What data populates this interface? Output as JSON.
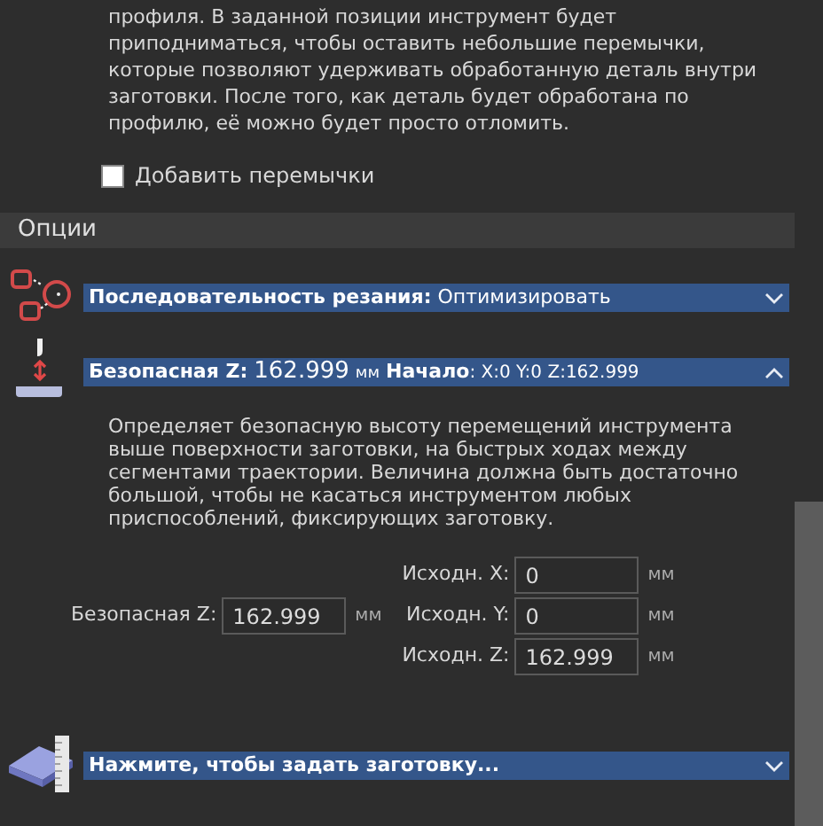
{
  "intro": {
    "text": "профиля. В заданной позиции инструмент будет приподниматься, чтобы оставить небольшие перемычки, которые позволяют удерживать обработанную деталь внутри заготовки. После того, как деталь будет обработана по профилю, её можно будет просто отломить."
  },
  "tabs_checkbox": {
    "label": "Добавить перемычки",
    "checked": false
  },
  "section": {
    "title": "Опции"
  },
  "cut_order": {
    "label": "Последовательность резания:",
    "value": "Оптимизировать",
    "expanded": false
  },
  "safe_z": {
    "label": "Безопасная Z:",
    "value": "162.999",
    "unit": "мм",
    "start_label": "Начало",
    "start_value": ": X:0 Y:0 Z:162.999",
    "expanded": true,
    "description": "Определяет безопасную высоту перемещений инструмента выше поверхности заготовки, на быстрых ходах между сегментами траектории. Величина должна быть достаточно большой, чтобы не касаться инструментом любых приспособлений, фиксирующих заготовку.",
    "field": {
      "label": "Безопасная Z:",
      "value": "162.999",
      "unit": "мм"
    },
    "origin_fields": [
      {
        "label": "Исходн. X:",
        "value": "0",
        "unit": "мм"
      },
      {
        "label": "Исходн. Y:",
        "value": "0",
        "unit": "мм"
      },
      {
        "label": "Исходн. Z:",
        "value": "162.999",
        "unit": "мм"
      }
    ]
  },
  "stock": {
    "label": "Нажмите, чтобы задать заготовку...",
    "expanded": false
  }
}
